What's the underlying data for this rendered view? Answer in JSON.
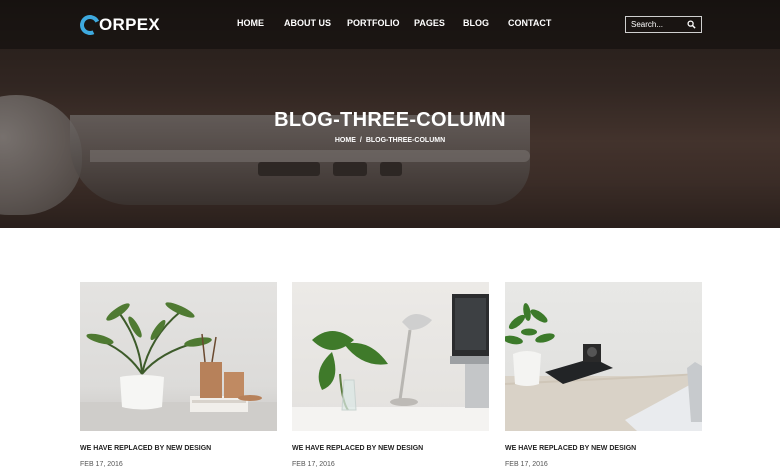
{
  "brand": {
    "logo_text": "ORPEX",
    "accent": "#3ea9de"
  },
  "nav": {
    "items": [
      {
        "label": "HOME"
      },
      {
        "label": "ABOUT US"
      },
      {
        "label": "PORTFOLIO"
      },
      {
        "label": "PAGES"
      },
      {
        "label": "BLOG"
      },
      {
        "label": "CONTACT"
      }
    ]
  },
  "search": {
    "placeholder": "Search...",
    "icon": "search-icon"
  },
  "hero": {
    "title": "BLOG-THREE-COLUMN",
    "breadcrumb": {
      "home": "HOME",
      "separator": "/",
      "current": "BLOG-THREE-COLUMN"
    }
  },
  "posts": [
    {
      "title": "WE HAVE REPLACED BY NEW DESIGN",
      "date": "FEB 17, 2016"
    },
    {
      "title": "WE HAVE REPLACED BY NEW DESIGN",
      "date": "FEB 17, 2016"
    },
    {
      "title": "WE HAVE REPLACED BY NEW DESIGN",
      "date": "FEB 17, 2016"
    }
  ]
}
